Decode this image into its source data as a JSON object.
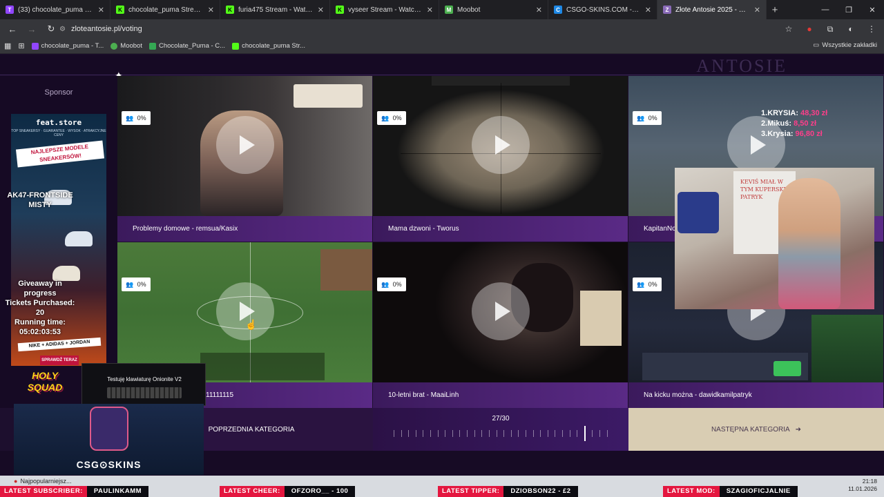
{
  "browser": {
    "tabs": [
      {
        "title": "(33) chocolate_puma - Twitch",
        "color": "#9146ff",
        "glyph": "T"
      },
      {
        "title": "chocolate_puma Stream - Watc",
        "color": "#53fc18",
        "glyph": "K"
      },
      {
        "title": "furia475 Stream - Watch Live o",
        "color": "#53fc18",
        "glyph": "K"
      },
      {
        "title": "vyseer Stream - Watch Live on I",
        "color": "#53fc18",
        "glyph": "K"
      },
      {
        "title": "Moobot",
        "color": "#4caf50",
        "glyph": "M"
      },
      {
        "title": "CSGO-SKINS.COM - Najlepsze",
        "color": "#1e88e5",
        "glyph": "C"
      },
      {
        "title": "Złote Antosie 2025 - Największ",
        "color": "#8a6bb8",
        "glyph": "Z"
      }
    ],
    "active_tab": 6,
    "url": "zloteantosie.pl/voting",
    "bookmarks": [
      {
        "label": "chocolate_puma - T...",
        "color": "#9146ff"
      },
      {
        "label": "Moobot",
        "color": "#4caf50"
      },
      {
        "label": "Chocolate_Puma - C...",
        "color": "#34a853"
      },
      {
        "label": "chocolate_puma Str...",
        "color": "#53fc18"
      }
    ],
    "all_bookmarks": "Wszystkie zakładki"
  },
  "page": {
    "sponsor_label": "Sponsor",
    "ad": {
      "brand": "feat.store",
      "tagline": "TOP SNEAKERSY · GUARANTEE · WYSOK · ATRAKCYJNE CENY",
      "ribbon": "NAJLEPSZE MODELE SNEAKERSÓW!",
      "strip": "NIKE + ADIDAS + JORDAN",
      "cta": "SPRAWDŹ TERAZ"
    },
    "videos": [
      {
        "title": "Problemy domowe - remsua/Kasix",
        "votes": "0%"
      },
      {
        "title": "Mama dzwoni - Tworus",
        "votes": "0%"
      },
      {
        "title": "KapitanNoc",
        "votes": "0%"
      },
      {
        "title": "11111115",
        "votes": "0%"
      },
      {
        "title": "10-letni brat - MaaiLinh",
        "votes": "0%"
      },
      {
        "title": "Na kicku można - dawidkamilpatryk",
        "votes": "0%"
      }
    ],
    "pager": {
      "prev": "POPRZEDNIA KATEGORIA",
      "counter": "27/30",
      "current": 27,
      "total": 30,
      "next": "NASTĘPNA KATEGORIA"
    }
  },
  "stream_overlays": {
    "leaderboard": [
      {
        "rank": "1.",
        "name": "KRYSIA:",
        "value": "48,30 zł"
      },
      {
        "rank": "2.",
        "name": "Mikuś:",
        "value": "8,50 zł"
      },
      {
        "rank": "3.",
        "name": "Krysia:",
        "value": "96,80 zł"
      }
    ],
    "giveaway": {
      "item": "AK47-FRONTSIDE MISTY",
      "line1": "Giveaway in progress",
      "line2": "Tickets Purchased: 20",
      "line3": "Running time: 05:02:03:53"
    },
    "holy": "HOLY SQUAD",
    "keyboard_ad": "Testuję klawiaturę Onionite V2",
    "csg_logo": "CSG⊙SKINS",
    "board_text": "KEVIŚ MIAŁ W TYM KUPERSKI PATRYK",
    "tickers": [
      {
        "label": "LATEST SUBSCRIBER:",
        "value": "PAULINKAMM"
      },
      {
        "label": "LATEST CHEER:",
        "value": "OFZORO__ - 100"
      },
      {
        "label": "LATEST TIPPER:",
        "value": "DZIOBSON22 - £2"
      },
      {
        "label": "LATEST MOD:",
        "value": "SZAGIOFICJALNIE"
      }
    ]
  },
  "taskbar": {
    "notification": "Najpopularniejsz...",
    "time": "21:18",
    "date": "11.01.2026"
  }
}
